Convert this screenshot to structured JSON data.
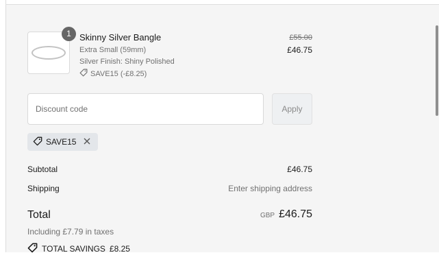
{
  "product": {
    "quantity": "1",
    "name": "Skinny Silver Bangle",
    "variant": "Extra Small (59mm)",
    "finish": "Silver Finish: Shiny Polished",
    "discount_label": "SAVE15 (-£8.25)",
    "original_price": "£55.00",
    "price": "£46.75"
  },
  "discount_form": {
    "placeholder": "Discount code",
    "apply_label": "Apply"
  },
  "applied_code": {
    "code": "SAVE15"
  },
  "summary": {
    "subtotal_label": "Subtotal",
    "subtotal_value": "£46.75",
    "shipping_label": "Shipping",
    "shipping_value": "Enter shipping address",
    "total_label": "Total",
    "currency": "GBP",
    "total_value": "£46.75",
    "taxes_note": "Including £7.79 in taxes",
    "savings_label": "TOTAL SAVINGS",
    "savings_value": "£8.25"
  },
  "icons": {
    "tag": "tag-icon",
    "close": "close-icon",
    "savings_tag": "tag-icon"
  }
}
